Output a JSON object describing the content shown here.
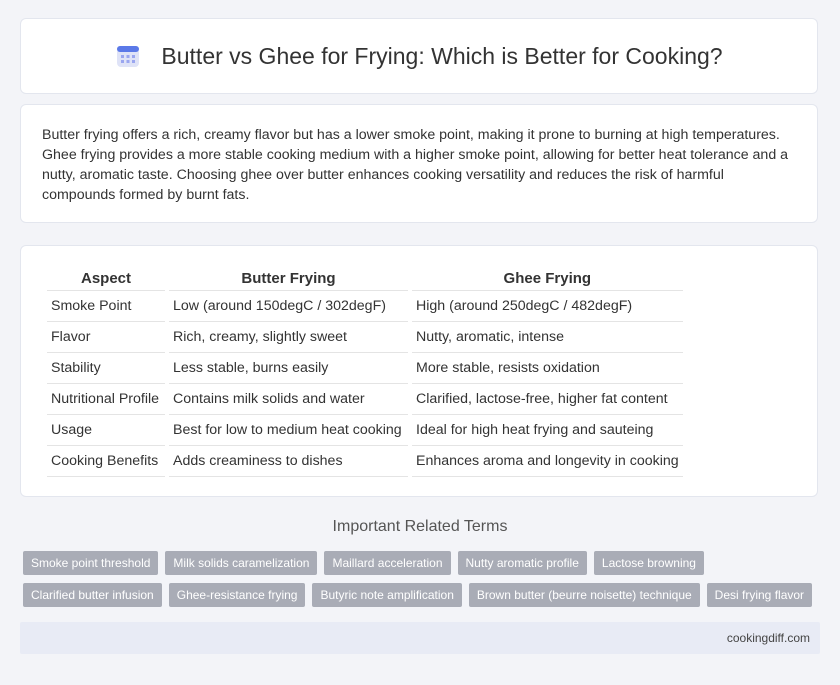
{
  "header": {
    "title": "Butter vs Ghee for Frying: Which is Better for Cooking?",
    "icon": "calendar-icon"
  },
  "intro": {
    "text": "Butter frying offers a rich, creamy flavor but has a lower smoke point, making it prone to burning at high temperatures. Ghee frying provides a more stable cooking medium with a higher smoke point, allowing for better heat tolerance and a nutty, aromatic taste. Choosing ghee over butter enhances cooking versatility and reduces the risk of harmful compounds formed by burnt fats."
  },
  "table": {
    "headers": [
      "Aspect",
      "Butter Frying",
      "Ghee Frying"
    ],
    "rows": [
      [
        "Smoke Point",
        "Low (around 150degC / 302degF)",
        "High (around 250degC / 482degF)"
      ],
      [
        "Flavor",
        "Rich, creamy, slightly sweet",
        "Nutty, aromatic, intense"
      ],
      [
        "Stability",
        "Less stable, burns easily",
        "More stable, resists oxidation"
      ],
      [
        "Nutritional Profile",
        "Contains milk solids and water",
        "Clarified, lactose-free, higher fat content"
      ],
      [
        "Usage",
        "Best for low to medium heat cooking",
        "Ideal for high heat frying and sauteing"
      ],
      [
        "Cooking Benefits",
        "Adds creaminess to dishes",
        "Enhances aroma and longevity in cooking"
      ]
    ]
  },
  "related": {
    "title": "Important Related Terms",
    "row1": [
      "Smoke point threshold",
      "Milk solids caramelization",
      "Maillard acceleration",
      "Nutty aromatic profile",
      "Lactose browning"
    ],
    "row2": [
      "Clarified butter infusion",
      "Ghee-resistance frying",
      "Butyric note amplification",
      "Brown butter (beurre noisette) technique",
      "Desi frying flavor"
    ]
  },
  "footer": {
    "site": "cookingdiff.com"
  }
}
